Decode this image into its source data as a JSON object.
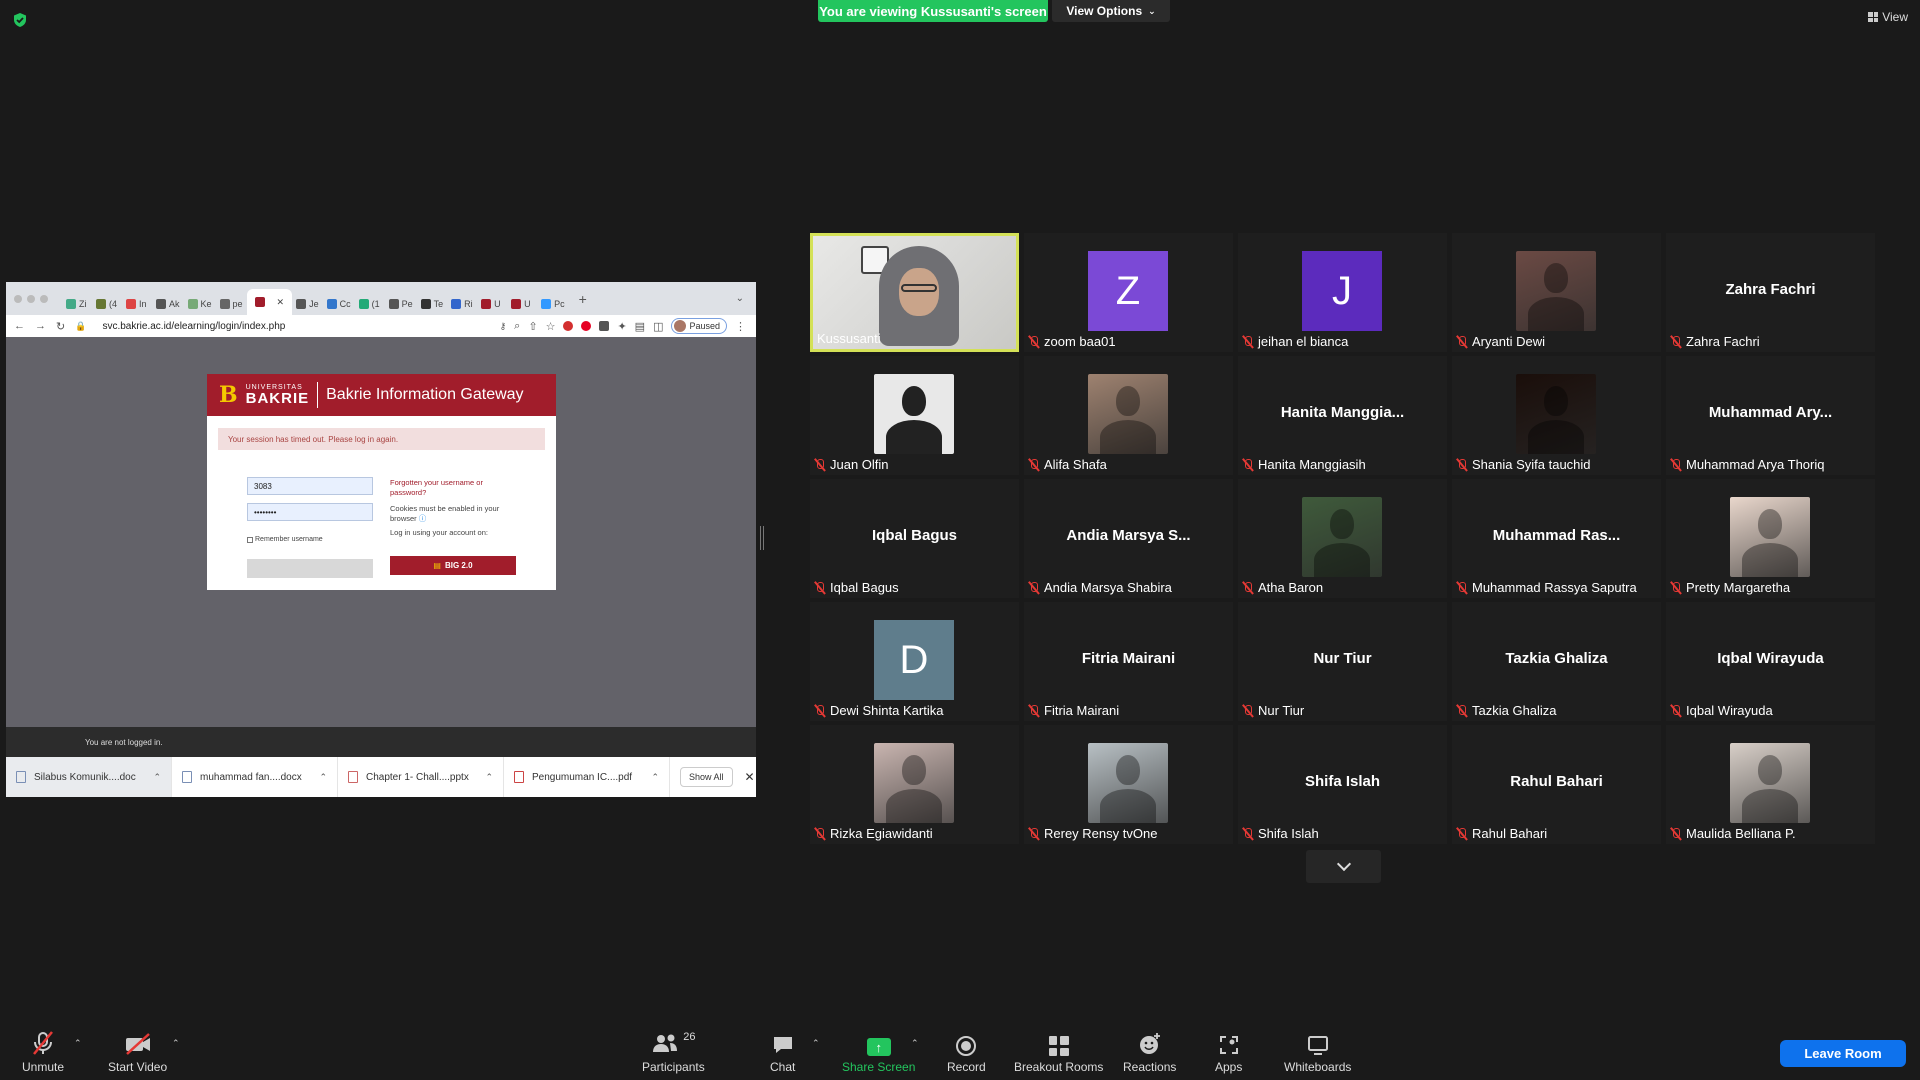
{
  "top": {
    "viewing_banner": "You are viewing Kussusanti's screen",
    "view_options": "View Options",
    "view_label": "View"
  },
  "shared": {
    "tabs": [
      "Zi",
      "(4",
      "In",
      "Ak",
      "Ke",
      "pe",
      "",
      "Je",
      "Cc",
      "(1",
      "Pe",
      "Te",
      "Ri",
      "U",
      "U",
      "Pc"
    ],
    "url": "svc.bakrie.ac.id/elearning/login/index.php",
    "paused": "Paused",
    "login": {
      "univ_small": "UNIVERSITAS",
      "univ_name": "BAKRIE",
      "gateway_title": "Bakrie Information Gateway",
      "alert": "Your session has timed out. Please log in again.",
      "username": "3083",
      "password": "••••••••",
      "remember": "Remember username",
      "forgot": "Forgotten your username or password?",
      "cookies": "Cookies must be enabled in your browser",
      "login_using": "Log in using your account on:",
      "big_button": "BIG 2.0"
    },
    "not_logged_in": "You are not logged in.",
    "downloads": [
      {
        "name": "Silabus Komunik....doc",
        "type": "doc"
      },
      {
        "name": "muhammad fan....docx",
        "type": "doc"
      },
      {
        "name": "Chapter 1- Chall....pptx",
        "type": "ppt"
      },
      {
        "name": "Pengumuman IC....pdf",
        "type": "pdf"
      }
    ],
    "show_all": "Show All"
  },
  "participants": [
    {
      "name": "Kussusanti",
      "kind": "webcam",
      "muted": false
    },
    {
      "name": "zoom baa01",
      "kind": "initial",
      "initial": "Z",
      "color": "#7b49d6",
      "muted": true
    },
    {
      "name": "jeihan el bianca",
      "kind": "initial",
      "initial": "J",
      "color": "#5c2bbd",
      "muted": true
    },
    {
      "name": "Aryanti Dewi",
      "kind": "photo",
      "color": "#6b4a44",
      "muted": true
    },
    {
      "name": "Zahra Fachri",
      "kind": "text",
      "big": "Zahra Fachri",
      "muted": true
    },
    {
      "name": "Juan Olfin",
      "kind": "silhouette",
      "muted": true
    },
    {
      "name": "Alifa Shafa",
      "kind": "photo",
      "color": "#9e8270",
      "muted": true
    },
    {
      "name": "Hanita Manggiasih",
      "kind": "text",
      "big": "Hanita  Manggia...",
      "muted": true
    },
    {
      "name": "Shania Syifa tauchid",
      "kind": "photo",
      "color": "#1a0e0a",
      "muted": true
    },
    {
      "name": "Muhammad Arya Thoriq",
      "kind": "text",
      "big": "Muhammad  Ary...",
      "muted": true
    },
    {
      "name": "Iqbal Bagus",
      "kind": "text",
      "big": "Iqbal Bagus",
      "muted": true
    },
    {
      "name": "Andia Marsya Shabira",
      "kind": "text",
      "big": "Andia  Marsya  S...",
      "muted": true
    },
    {
      "name": "Atha Baron",
      "kind": "photo",
      "color": "#3f5a3b",
      "muted": true
    },
    {
      "name": "Muhammad Rassya Saputra",
      "kind": "text",
      "big": "Muhammad  Ras...",
      "muted": true
    },
    {
      "name": "Pretty Margaretha",
      "kind": "photo",
      "color": "#e9d7cc",
      "muted": true
    },
    {
      "name": "Dewi Shinta Kartika",
      "kind": "initial",
      "initial": "D",
      "color": "#5f7d8c",
      "muted": true
    },
    {
      "name": "Fitria Mairani",
      "kind": "text",
      "big": "Fitria Mairani",
      "muted": true
    },
    {
      "name": "Nur Tiur",
      "kind": "text",
      "big": "Nur Tiur",
      "muted": true
    },
    {
      "name": "Tazkia Ghaliza",
      "kind": "text",
      "big": "Tazkia Ghaliza",
      "muted": true
    },
    {
      "name": "Iqbal Wirayuda",
      "kind": "text",
      "big": "Iqbal Wirayuda",
      "muted": true
    },
    {
      "name": "Rizka Egiawidanti",
      "kind": "photo",
      "color": "#c9b5b0",
      "muted": true
    },
    {
      "name": "Rerey Rensy tvOne",
      "kind": "photo",
      "color": "#b8c0c4",
      "muted": true
    },
    {
      "name": "Shifa Islah",
      "kind": "text",
      "big": "Shifa Islah",
      "muted": true
    },
    {
      "name": "Rahul Bahari",
      "kind": "text",
      "big": "Rahul Bahari",
      "muted": true
    },
    {
      "name": "Maulida Belliana P.",
      "kind": "photo",
      "color": "#d8cfc8",
      "muted": true
    }
  ],
  "toolbar": {
    "unmute": "Unmute",
    "start_video": "Start Video",
    "participants": "Participants",
    "participants_count": "26",
    "chat": "Chat",
    "share_screen": "Share Screen",
    "record": "Record",
    "breakout_rooms": "Breakout Rooms",
    "reactions": "Reactions",
    "apps": "Apps",
    "whiteboards": "Whiteboards",
    "leave_room": "Leave Room"
  },
  "colors": {
    "share_green": "#23c55e",
    "active_speaker": "#d4e157",
    "leave_blue": "#0e72ed",
    "muted_red": "#e53935"
  }
}
